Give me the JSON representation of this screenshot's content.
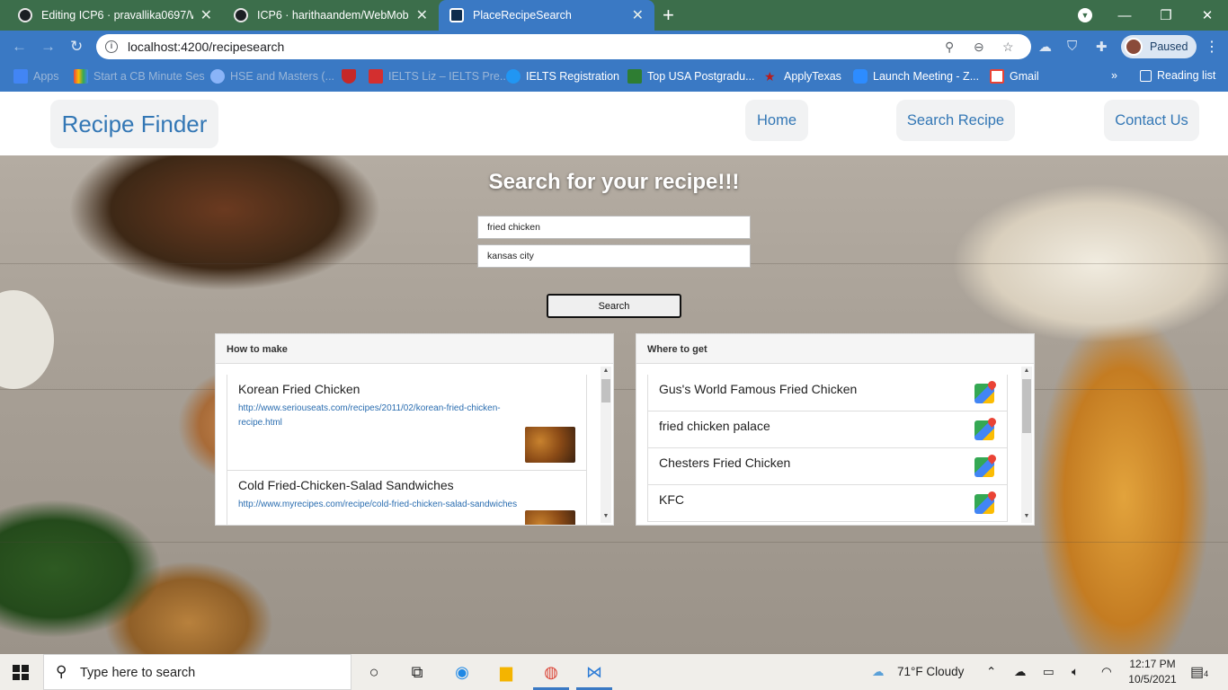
{
  "browser": {
    "tabs": [
      {
        "title": "Editing ICP6 · pravallika0697/Wel",
        "active": false
      },
      {
        "title": "ICP6 · harithaandem/WebMobile",
        "active": false
      },
      {
        "title": "PlaceRecipeSearch",
        "active": true
      }
    ],
    "url": "localhost:4200/recipesearch",
    "profile_status": "Paused",
    "bookmarks": [
      {
        "label": "Apps",
        "color": "#4285f4"
      },
      {
        "label": "Start a CB Minute Ses",
        "color": "#e8453c"
      },
      {
        "label": "HSE and Masters (...",
        "color": "#8ab4f8"
      },
      {
        "label": "",
        "color": "#c62828"
      },
      {
        "label": "IELTS Liz – IELTS Pre...",
        "color": "#d32f2f"
      },
      {
        "label": "IELTS Registration",
        "color": "#2196f3"
      },
      {
        "label": "Top USA Postgradu...",
        "color": "#2e7d32"
      },
      {
        "label": "ApplyTexas",
        "color": "#b71c1c"
      },
      {
        "label": "Launch Meeting - Z...",
        "color": "#2d8cff"
      },
      {
        "label": "Gmail",
        "color": "#ea4335"
      }
    ],
    "reading_list": "Reading list",
    "accent": "#3a79c4",
    "tabstrip_color": "#3c6e4b"
  },
  "site": {
    "brand": "Recipe Finder",
    "nav": [
      "Home",
      "Search Recipe",
      "Contact Us"
    ],
    "link_color": "#3377b5"
  },
  "search": {
    "title": "Search for your recipe!!!",
    "recipe_query": "fried chicken",
    "location_query": "kansas city",
    "button": "Search"
  },
  "how_to_make": {
    "heading": "How to make",
    "items": [
      {
        "name": "Korean Fried Chicken",
        "url": "http://www.seriouseats.com/recipes/2011/02/korean-fried-chicken-recipe.html"
      },
      {
        "name": "Cold Fried-Chicken-Salad Sandwiches",
        "url": "http://www.myrecipes.com/recipe/cold-fried-chicken-salad-sandwiches"
      }
    ]
  },
  "where_to_get": {
    "heading": "Where to get",
    "items": [
      {
        "name": "Gus's World Famous Fried Chicken"
      },
      {
        "name": "fried chicken palace"
      },
      {
        "name": "Chesters Fried Chicken"
      },
      {
        "name": "KFC"
      }
    ]
  },
  "taskbar": {
    "search_placeholder": "Type here to search",
    "weather": "71°F  Cloudy",
    "time": "12:17 PM",
    "date": "10/5/2021",
    "notifications": "4"
  }
}
